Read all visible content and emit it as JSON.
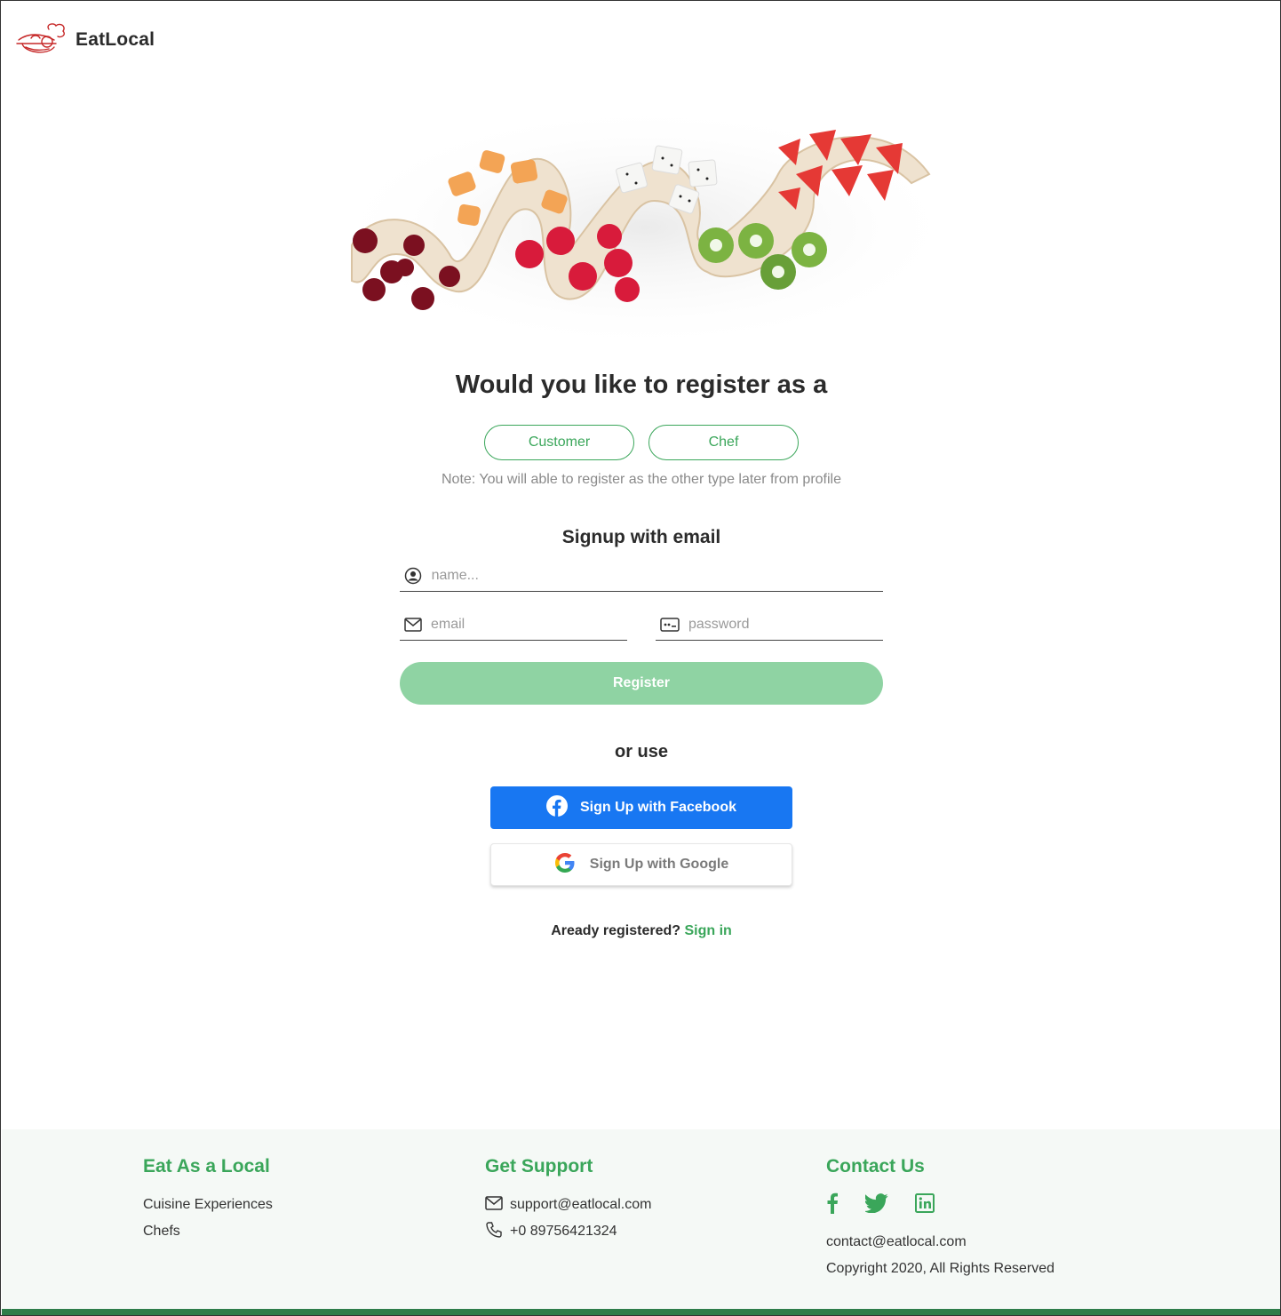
{
  "brand": {
    "name": "EatLocal",
    "accent_color": "#3aa65a",
    "logo_color": "#c62828"
  },
  "hero": {
    "image_desc": "hero-food-image"
  },
  "register": {
    "headline": "Would you like to register as a",
    "roles": [
      "Customer",
      "Chef"
    ],
    "note": "Note: You will able to register as the other type later from profile",
    "signup_title": "Signup with email",
    "name_placeholder": "name...",
    "email_placeholder": "email",
    "password_placeholder": "password",
    "register_label": "Register",
    "or_use": "or use",
    "facebook_label": "Sign Up with Facebook",
    "google_label": "Sign Up with Google",
    "already_text": "Aready registered?",
    "sign_in_label": "Sign in"
  },
  "footer": {
    "col1": {
      "title": "Eat As a Local",
      "links": [
        "Cuisine Experiences",
        "Chefs"
      ]
    },
    "col2": {
      "title": "Get Support",
      "email": "support@eatlocal.com",
      "phone": "+0 89756421324"
    },
    "col3": {
      "title": "Contact Us",
      "social_icons": [
        "facebook-icon",
        "twitter-icon",
        "linkedin-icon"
      ],
      "email": "contact@eatlocal.com",
      "copyright": "Copyright 2020, All Rights Reserved"
    }
  }
}
